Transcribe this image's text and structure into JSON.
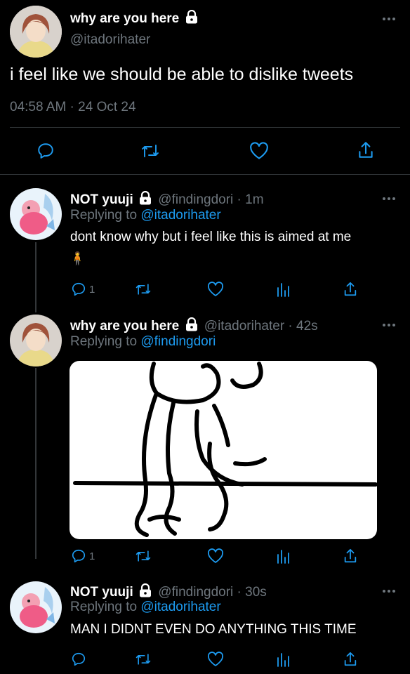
{
  "main_tweet": {
    "name": "why are you here",
    "handle": "@itadorihater",
    "text": "i feel like we should be able to dislike tweets",
    "timestamp": "04:58 AM · 24 Oct 24"
  },
  "replies": [
    {
      "name": "NOT yuuji",
      "handle": "@findingdori",
      "time": "· 1m",
      "replying_prefix": "Replying to",
      "replying_to": "@itadorihater",
      "text": "dont know why but i feel like this is aimed at me",
      "emoji": "🧍",
      "reply_count": "1"
    },
    {
      "name": "why are you here",
      "handle": "@itadorihater",
      "time": "· 42s",
      "replying_prefix": "Replying to",
      "replying_to": "@findingdori",
      "reply_count": "1"
    },
    {
      "name": "NOT yuuji",
      "handle": "@findingdori",
      "time": "· 30s",
      "replying_prefix": "Replying to",
      "replying_to": "@itadorihater",
      "text": "MAN I DIDNT EVEN DO ANYTHING THIS TIME"
    }
  ],
  "colors": {
    "accent": "#1d9bf0",
    "muted": "#6e767d",
    "background": "#000000"
  },
  "icons": [
    "lock-icon",
    "more-icon",
    "reply-icon",
    "retweet-icon",
    "like-icon",
    "share-icon",
    "analytics-icon"
  ]
}
